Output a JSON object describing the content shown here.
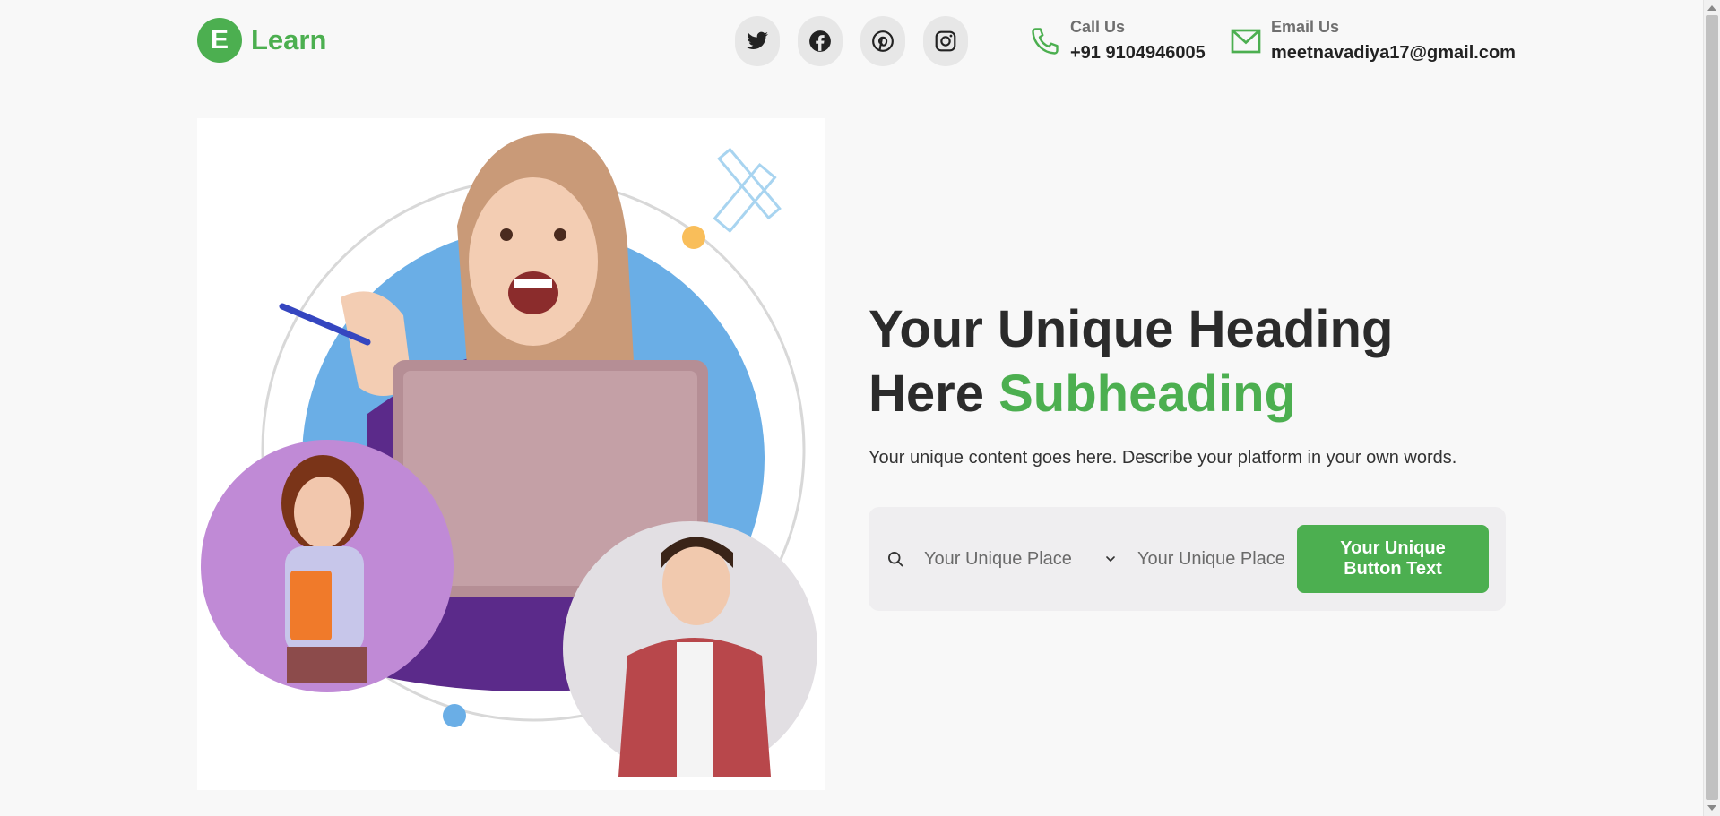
{
  "brand": {
    "initial": "E",
    "name": "Learn",
    "color": "#4caf50"
  },
  "socials": [
    {
      "name": "twitter-icon"
    },
    {
      "name": "facebook-icon"
    },
    {
      "name": "pinterest-icon"
    },
    {
      "name": "instagram-icon"
    }
  ],
  "contact": {
    "call_label": "Call Us",
    "call_value": "+91 9104946005",
    "email_label": "Email Us",
    "email_value": "meetnavadiya17@gmail.com"
  },
  "hero": {
    "heading_main": "Your Unique Heading Here ",
    "heading_accent": "Subheading",
    "description": "Your unique content goes here. Describe your platform in your own words."
  },
  "search": {
    "field1_placeholder": "Your Unique Place",
    "field2_placeholder": "Your Unique Place",
    "button_label": "Your Unique Button Text"
  },
  "colors": {
    "accent": "#4caf50",
    "circle_blue": "#6aaee6",
    "circle_purple": "#c08ad6",
    "dot_orange": "#f9be5a"
  }
}
